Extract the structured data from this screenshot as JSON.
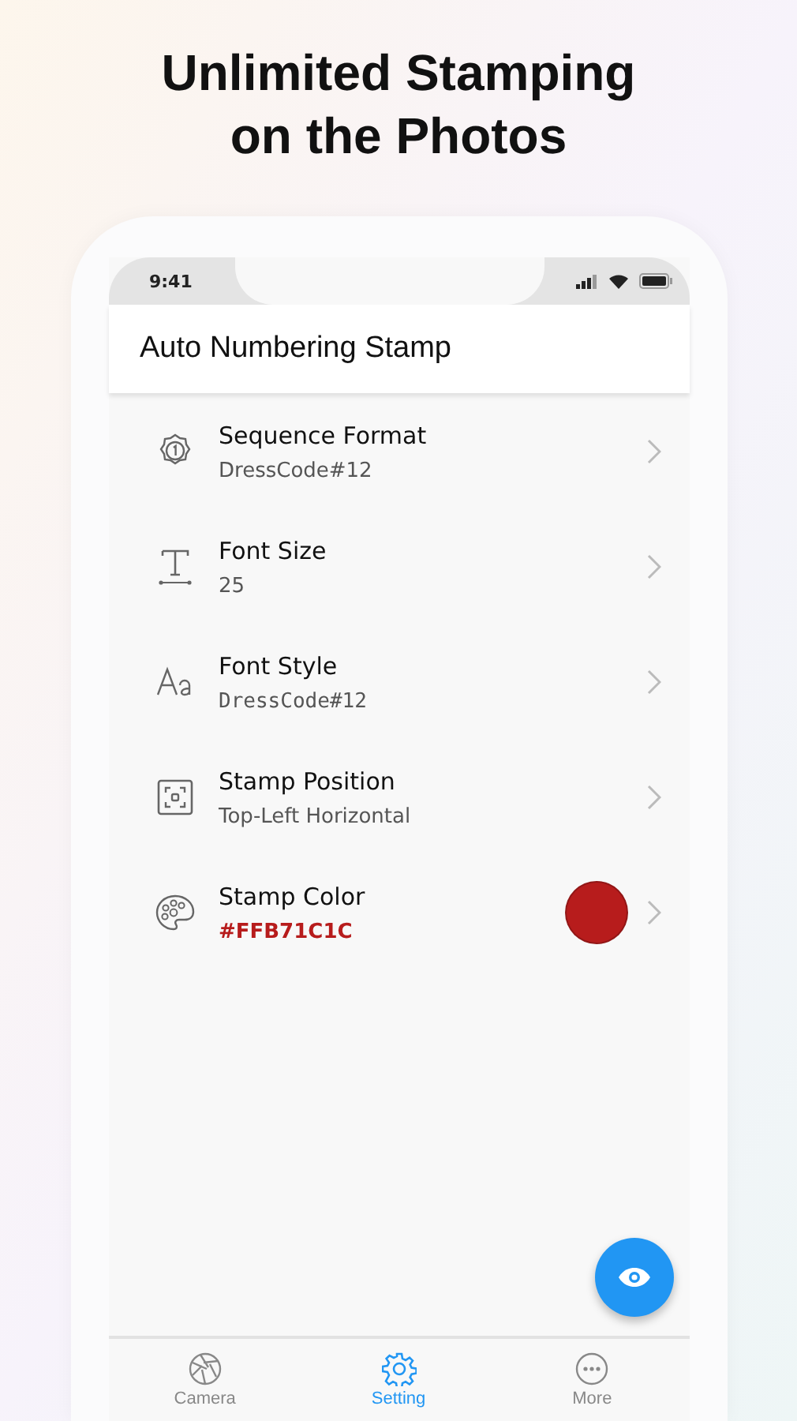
{
  "headline": [
    "Unlimited Stamping",
    "on the Photos"
  ],
  "status_bar": {
    "time": "9:41"
  },
  "app_bar": {
    "title": "Auto Numbering Stamp"
  },
  "settings": [
    {
      "kind": "format",
      "label": "Sequence Format",
      "value": "DressCode#12"
    },
    {
      "kind": "size",
      "label": "Font Size",
      "value": "25"
    },
    {
      "kind": "style",
      "label": "Font Style",
      "value": "DressCode#12"
    },
    {
      "kind": "position",
      "label": "Stamp Position",
      "value": "Top-Left Horizontal"
    },
    {
      "kind": "color",
      "label": "Stamp Color",
      "value": "#FFB71C1C",
      "color": "#b71c1c"
    }
  ],
  "tabs": [
    {
      "kind": "camera",
      "label": "Camera",
      "selected": false
    },
    {
      "kind": "setting",
      "label": "Setting",
      "selected": true
    },
    {
      "kind": "more",
      "label": "More",
      "selected": false
    }
  ]
}
